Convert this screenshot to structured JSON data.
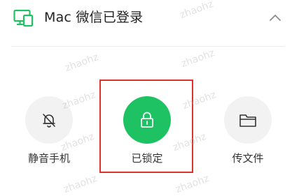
{
  "header": {
    "title": "Mac 微信已登录",
    "device_icon": "desktop-monitor-icon",
    "collapse_icon": "chevron-up-icon"
  },
  "actions": [
    {
      "label": "静音手机",
      "icon": "bell-mute-icon",
      "state": "inactive"
    },
    {
      "label": "已锁定",
      "icon": "lock-icon",
      "state": "active"
    },
    {
      "label": "传文件",
      "icon": "folder-icon",
      "state": "inactive"
    }
  ],
  "colors": {
    "accent_green": "#1fc262",
    "highlight_red": "#e0322b",
    "neutral_circle": "#f2f2f2"
  },
  "watermark": "zhaohz"
}
